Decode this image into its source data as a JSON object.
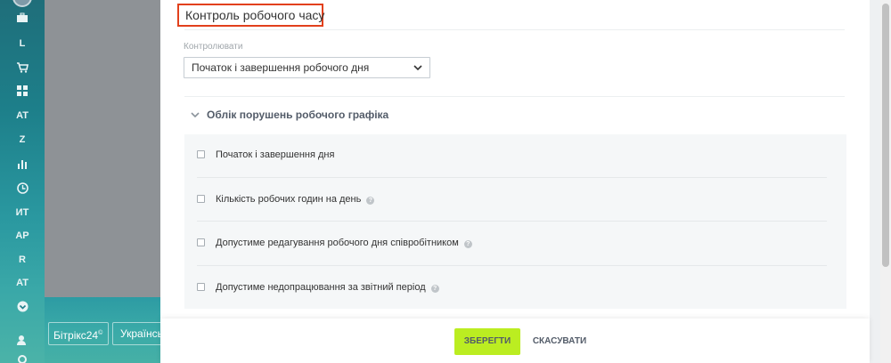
{
  "sidebar": {
    "items": [
      {
        "label": "L"
      },
      {
        "label": "AT"
      },
      {
        "label": "Z"
      },
      {
        "label": "ИТ"
      },
      {
        "label": "AP"
      },
      {
        "label": "R"
      },
      {
        "label": "AT"
      }
    ],
    "brand": "Бітрікс24",
    "brand_sup": "©",
    "language": "Українська"
  },
  "section": {
    "title": "Контроль робочого часу",
    "control_label": "Контролювати",
    "control_value": "Початок і завершення робочого дня"
  },
  "violations": {
    "header": "Облік порушень робочого графіка",
    "options": [
      {
        "label": "Початок і завершення дня",
        "help": false
      },
      {
        "label": "Кількість робочих годин на день",
        "help": true
      },
      {
        "label": "Допустиме редагування робочого дня співробітником",
        "help": true
      },
      {
        "label": "Допустиме недопрацювання за звітний період",
        "help": true
      }
    ]
  },
  "footer": {
    "save_label": "ЗБЕРЕГТИ",
    "cancel_label": "СКАСУВАТИ"
  },
  "colors": {
    "highlight_border": "#e2401c",
    "save_button": "#bbed21"
  }
}
